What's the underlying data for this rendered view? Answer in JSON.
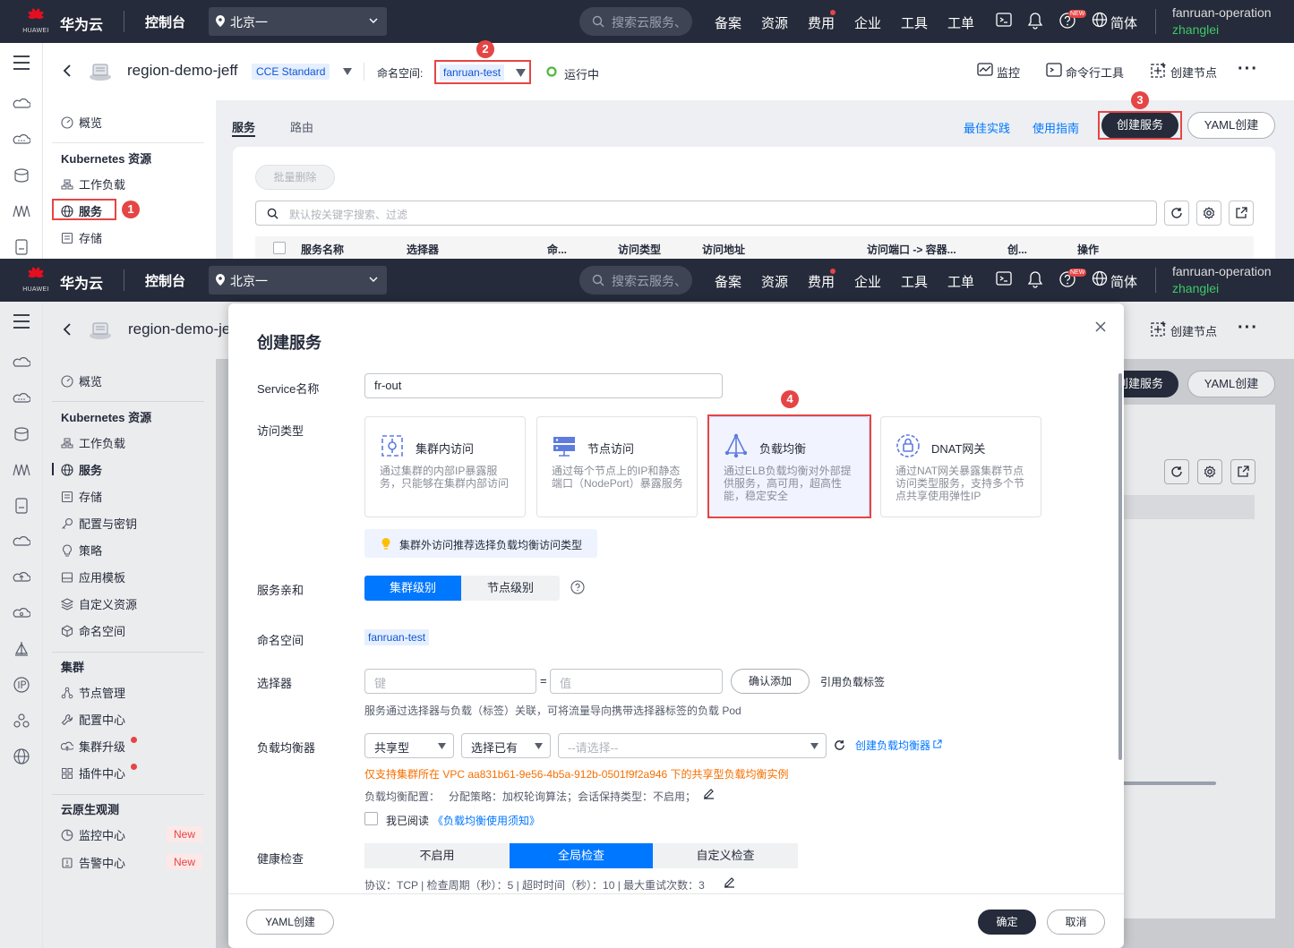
{
  "top": {
    "brand": "华为云",
    "logo_text": "HUAWEI",
    "console": "控制台",
    "region": "北京一",
    "search_placeholder": "搜索云服务、",
    "nav": [
      "备案",
      "资源",
      "费用",
      "企业",
      "工具",
      "工单"
    ],
    "new_badge": "NEW",
    "lang": "简体",
    "user_account": "fanruan-operation",
    "user_name": "zhanglei"
  },
  "cluster_header": {
    "cluster_name": "region-demo-jeff",
    "edition": "CCE Standard",
    "namespace_label": "命名空间:",
    "namespace_value": "fanruan-test",
    "status": "运行中",
    "actions": [
      "监控",
      "命令行工具",
      "创建节点"
    ]
  },
  "sidebar": {
    "overview": "概览",
    "k8s_section": "Kubernetes 资源",
    "k8s_items": [
      "工作负载",
      "服务",
      "存储",
      "配置与密钥",
      "策略",
      "应用模板",
      "自定义资源",
      "命名空间"
    ],
    "cluster_section": "集群",
    "cluster_items": [
      "节点管理",
      "配置中心",
      "集群升级",
      "插件中心"
    ],
    "observe_section": "云原生观测",
    "observe_items": [
      "监控中心",
      "告警中心"
    ],
    "new_tag": "New"
  },
  "service_page": {
    "tabs": [
      "服务",
      "路由"
    ],
    "links": [
      "最佳实践",
      "使用指南"
    ],
    "create_button": "创建服务",
    "yaml_button": "YAML创建",
    "batch_delete": "批量删除",
    "search_placeholder": "默认按关键字搜索、过滤",
    "columns": [
      "服务名称",
      "选择器",
      "命...",
      "访问类型",
      "访问地址",
      "访问端口 -> 容器...",
      "创...",
      "操作"
    ]
  },
  "annotations": [
    "1",
    "2",
    "3",
    "4"
  ],
  "dialog": {
    "title": "创建服务",
    "service_name_label": "Service名称",
    "service_name_value": "fr-out",
    "access_type_label": "访问类型",
    "access_types": [
      {
        "title": "集群内访问",
        "desc": "通过集群的内部IP暴露服务，只能够在集群内部访问"
      },
      {
        "title": "节点访问",
        "desc": "通过每个节点上的IP和静态端口（NodePort）暴露服务"
      },
      {
        "title": "负载均衡",
        "desc": "通过ELB负载均衡对外部提供服务，高可用，超高性能，稳定安全"
      },
      {
        "title": "DNAT网关",
        "desc": "通过NAT网关暴露集群节点访问类型服务，支持多个节点共享使用弹性IP"
      }
    ],
    "access_tip": "集群外访问推荐选择负载均衡访问类型",
    "affinity_label": "服务亲和",
    "affinity_options": [
      "集群级别",
      "节点级别"
    ],
    "namespace_label": "命名空间",
    "namespace_value": "fanruan-test",
    "selector_label": "选择器",
    "selector_key_ph": "键",
    "selector_eq": "=",
    "selector_val_ph": "值",
    "selector_add": "确认添加",
    "selector_ref": "引用负载标签",
    "selector_hint": "服务通过选择器与负载（标签）关联，可将流量导向携带选择器标签的负载 Pod",
    "lb_label": "负载均衡器",
    "lb_type": "共享型",
    "lb_mode": "选择已有",
    "lb_select_ph": "--请选择--",
    "lb_create_link": "创建负载均衡器",
    "lb_warning": "仅支持集群所在 VPC aa831b61-9e56-4b5a-912b-0501f9f2a946 下的共享型负载均衡实例",
    "lb_config": "负载均衡配置：   分配策略：加权轮询算法；会话保持类型：不启用；",
    "lb_agree_prefix": "我已阅读",
    "lb_agree_link": "《负载均衡使用须知》",
    "health_label": "健康检查",
    "health_options": [
      "不启用",
      "全局检查",
      "自定义检查"
    ],
    "health_detail": "协议：TCP | 检查周期（秒）：5 | 超时时间（秒）：10 | 最大重试次数：3",
    "footer_yaml": "YAML创建",
    "ok": "确定",
    "cancel": "取消"
  }
}
